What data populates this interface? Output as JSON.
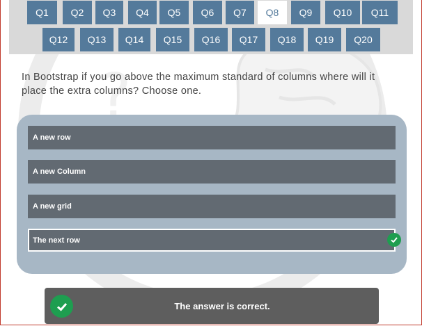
{
  "question_nav": {
    "row1": [
      "Q1",
      "Q2",
      "Q3",
      "Q4",
      "Q5",
      "Q6",
      "Q7",
      "Q8",
      "Q9",
      "Q10",
      "Q11"
    ],
    "row2": [
      "Q12",
      "Q13",
      "Q14",
      "Q15",
      "Q16",
      "Q17",
      "Q18",
      "Q19",
      "Q20"
    ],
    "active": "Q8"
  },
  "question": {
    "text": "In Bootstrap if you go above the maximum standard of columns where will it place the  extra columns? Choose one."
  },
  "answers": [
    {
      "label": "A new row",
      "selected": false
    },
    {
      "label": "A new Column",
      "selected": false
    },
    {
      "label": "A new grid",
      "selected": false
    },
    {
      "label": "The next row",
      "selected": true
    }
  ],
  "result": {
    "message": "The answer is correct.",
    "status_color": "#1e9e50",
    "icon": "check-circle-icon"
  },
  "colors": {
    "nav_button": "#547a9b",
    "nav_strip": "#d9d9d9",
    "answer_panel": "#a7b7c5",
    "answer_bg": "#626a72",
    "result_bg": "#5e5e5e"
  }
}
